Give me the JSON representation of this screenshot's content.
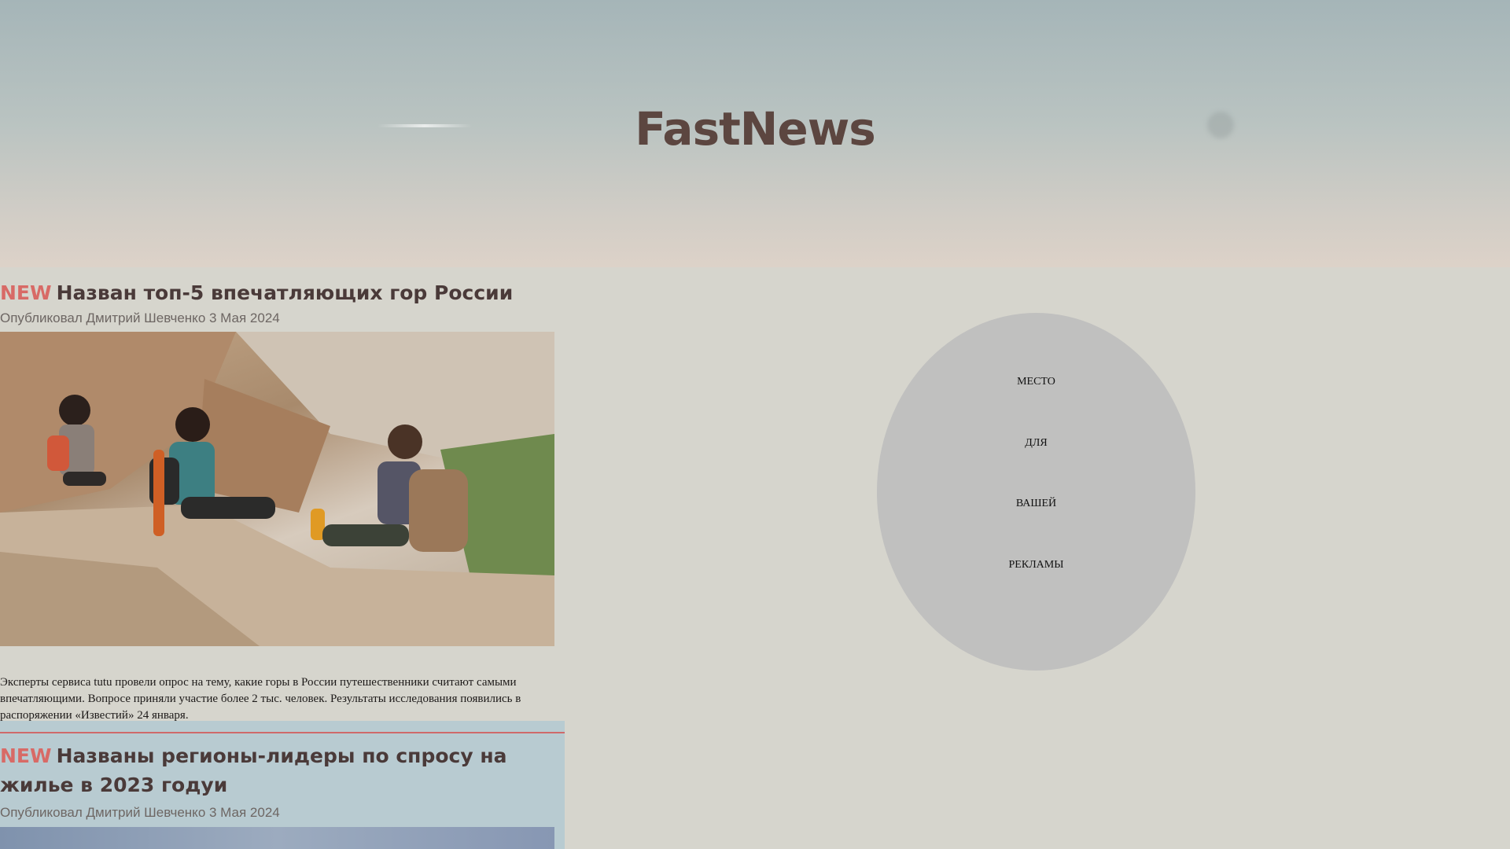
{
  "header": {
    "site_title": "FastNews"
  },
  "articles": [
    {
      "badge": "NEW",
      "title": "Назван топ-5 впечатляющих гор России",
      "byline": "Опубликовал Дмитрий Шевченко 3 Мая 2024",
      "summary": "Эксперты сервиса tutu провели опрос на тему, какие горы в России путешественники считают самыми впечатляющими. Вопросе приняли участие более 2 тыс. человек. Результаты исследования появились в распоряжении «Известий» 24 января."
    },
    {
      "badge": "NEW",
      "title": "Названы регионы-лидеры по спросу на жилье в 2023 годуи",
      "byline": "Опубликовал Дмитрий Шевченко 3 Мая 2024"
    }
  ],
  "ad": {
    "words": [
      "МЕСТО",
      "ДЛЯ",
      "ВАШЕЙ",
      "РЕКЛАМЫ"
    ]
  },
  "colors": {
    "badge": "#d86a66",
    "title": "#5c4640",
    "background": "#d6d5cd",
    "ad_circle": "#c0c0bf"
  }
}
